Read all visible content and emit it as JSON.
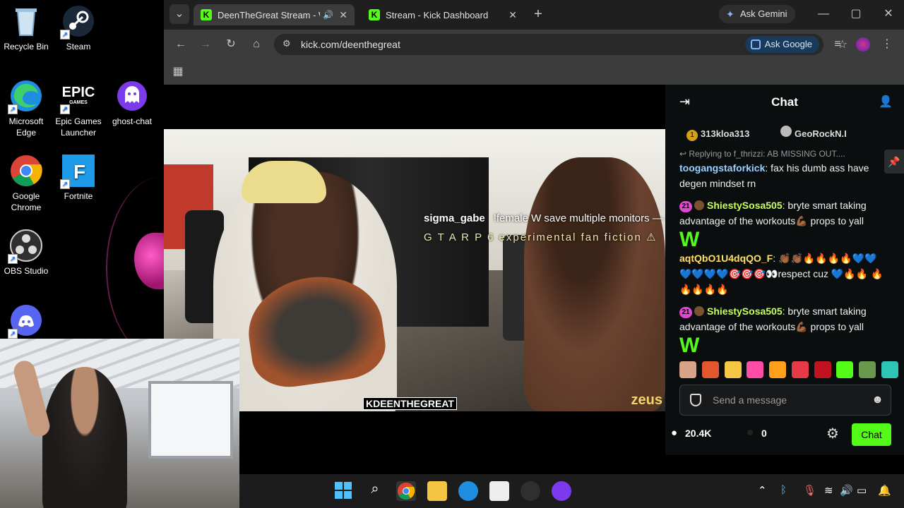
{
  "desktop": {
    "icons": [
      {
        "label": "Recycle Bin"
      },
      {
        "label": "Steam"
      },
      {
        "label": "Microsoft Edge"
      },
      {
        "label": "Epic Games Launcher"
      },
      {
        "label": "ghost-chat"
      },
      {
        "label": "Google Chrome"
      },
      {
        "label": "Fortnite"
      },
      {
        "label": "OBS Studio"
      }
    ],
    "epic_logo": "EPIC",
    "epic_logo_sub": "GAMES"
  },
  "browser": {
    "tabs": [
      {
        "title": "DeenTheGreat Stream - Wa",
        "icon": "kick-icon",
        "active": true
      },
      {
        "title": "Stream - Kick Dashboard",
        "icon": "kick-icon",
        "active": false
      }
    ],
    "ask_gemini": "Ask Gemini",
    "url": "kick.com/deenthegreat",
    "ask_google": "Ask Google"
  },
  "stream": {
    "overlay_user": "sigma_gabe",
    "overlay_text": "!female W save multiple monitors — chat is advised — this entire stream is only",
    "overlay_line2": "G T A R P 6 experimental fan fiction ⚠",
    "watermark": "KDEENTHEGREAT",
    "brand": "zeus"
  },
  "chat": {
    "title": "Chat",
    "pinned": [
      {
        "badge": "1",
        "user": "313kloa313"
      },
      {
        "badge": "",
        "user": "GeoRockN.I"
      }
    ],
    "reply": "Replying to f_thrizzi: AB MISSING OUT....",
    "messages": [
      {
        "user": "toogangstaforkick",
        "user_color": "#9ad0ff",
        "text": "fax his dumb ass have degen mindset rn",
        "sub": "",
        "w": false
      },
      {
        "user": "ShiestySosa505",
        "user_color": "#c7ff5a",
        "text": "bryte smart taking advantage of the workouts💪🏾 props to yall",
        "sub": "21",
        "w": true
      },
      {
        "user": "aqtQbO1U4dqQO_F",
        "user_color": "#ffe066",
        "text": "👏🏾👏🏾🔥🔥🔥🔥💙💙 💙💙💙💙🎯🎯🎯👀respect cuz 💙🔥🔥 🔥🔥🔥🔥🔥",
        "sub": "",
        "w": false
      },
      {
        "user": "ShiestySosa505",
        "user_color": "#c7ff5a",
        "text": "bryte smart taking advantage of the workouts💪🏾 props to yall",
        "sub": "21",
        "w": true
      }
    ],
    "w_emote": "W",
    "emotes": [
      "#d9a38a",
      "#e4572e",
      "#f6c744",
      "#ff4da6",
      "#ff9f1c",
      "#e63946",
      "#c1121f",
      "#53fc18",
      "#6a994e",
      "#2ec4b6"
    ],
    "input_placeholder": "Send a message",
    "viewers": "20.4K",
    "points": "0",
    "chat_button": "Chat"
  },
  "colors": {
    "kick_green": "#53fc18",
    "chat_bg": "#0b0e0f"
  }
}
